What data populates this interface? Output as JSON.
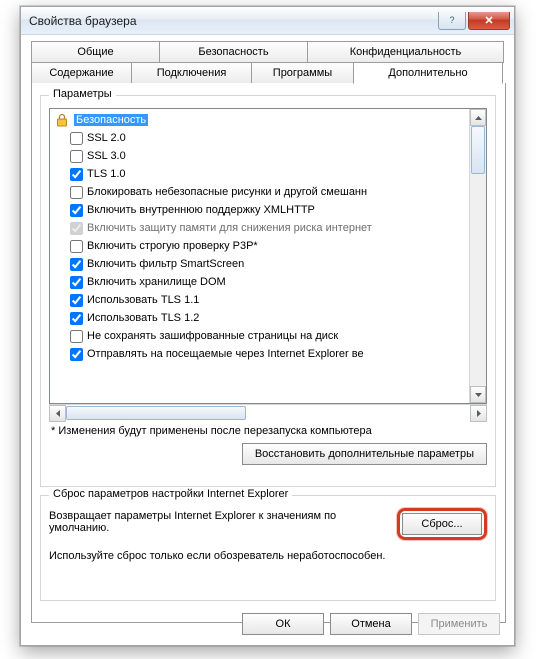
{
  "window": {
    "title": "Свойства браузера"
  },
  "tabs": {
    "row1": [
      "Общие",
      "Безопасность",
      "Конфиденциальность"
    ],
    "row2": [
      "Содержание",
      "Подключения",
      "Программы",
      "Дополнительно"
    ],
    "active": "Дополнительно"
  },
  "params": {
    "legend": "Параметры",
    "category": {
      "icon": "lock-icon",
      "label": "Безопасность"
    },
    "items": [
      {
        "label": "SSL 2.0",
        "checked": false
      },
      {
        "label": "SSL 3.0",
        "checked": false
      },
      {
        "label": "TLS 1.0",
        "checked": true
      },
      {
        "label": "Блокировать небезопасные рисунки и другой смешанн",
        "checked": false
      },
      {
        "label": "Включить внутреннюю поддержку XMLHTTP",
        "checked": true
      },
      {
        "label": "Включить защиту памяти для снижения риска интернет",
        "checked": true,
        "disabled": true
      },
      {
        "label": "Включить строгую проверку P3P*",
        "checked": false
      },
      {
        "label": "Включить фильтр SmartScreen",
        "checked": true
      },
      {
        "label": "Включить хранилище DOM",
        "checked": true
      },
      {
        "label": "Использовать TLS 1.1",
        "checked": true
      },
      {
        "label": "Использовать TLS 1.2",
        "checked": true
      },
      {
        "label": "Не сохранять зашифрованные страницы на диск",
        "checked": false
      },
      {
        "label": "Отправлять на посещаемые через Internet Explorer ве",
        "checked": true
      }
    ],
    "note": "* Изменения будут применены после перезапуска компьютера",
    "restore_btn": "Восстановить дополнительные параметры"
  },
  "reset": {
    "legend": "Сброс параметров настройки Internet Explorer",
    "desc": "Возвращает параметры Internet Explorer к значениям по умолчанию.",
    "btn": "Сброс...",
    "note": "Используйте сброс только если обозреватель неработоспособен."
  },
  "buttons": {
    "ok": "ОК",
    "cancel": "Отмена",
    "apply": "Применить"
  }
}
